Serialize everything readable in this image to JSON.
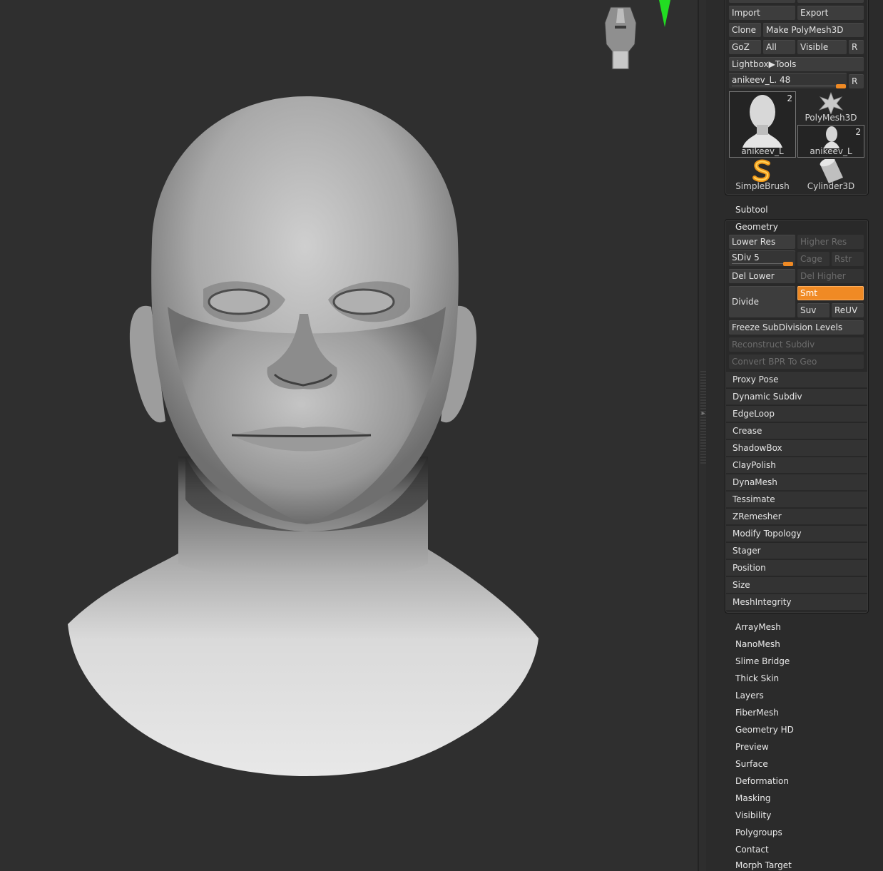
{
  "tool_top": {
    "import_label": "Import",
    "export_label": "Export",
    "clone_label": "Clone",
    "make_polymesh_label": "Make PolyMesh3D",
    "goz_label": "GoZ",
    "all_label": "All",
    "visible_label": "Visible",
    "r_label": "R",
    "lightbox_label": "Lightbox▶Tools",
    "current_tool_label": "anikeev_L. 48",
    "current_tool_value": 48,
    "r2_label": "R"
  },
  "tool_thumbs": [
    {
      "label": "anikeev_L",
      "count": "2",
      "icon": "head-bust-icon"
    },
    {
      "label": "PolyMesh3D",
      "count": "",
      "icon": "polymesh-star-icon"
    },
    {
      "label": "anikeev_L",
      "count": "2",
      "icon": "head-bust-small-icon"
    },
    {
      "label": "SimpleBrush",
      "count": "",
      "icon": "simplebrush-icon"
    },
    {
      "label": "Cylinder3D",
      "count": "",
      "icon": "cylinder-icon"
    }
  ],
  "subtool_label": "Subtool",
  "geometry": {
    "title": "Geometry",
    "lower_res": "Lower Res",
    "higher_res": "Higher Res",
    "sdiv_label": "SDiv 5",
    "sdiv_value": 5,
    "cage": "Cage",
    "rstr": "Rstr",
    "del_lower": "Del Lower",
    "del_higher": "Del Higher",
    "divide": "Divide",
    "smt": "Smt",
    "suv": "Suv",
    "reuv": "ReUV",
    "freeze": "Freeze SubDivision Levels",
    "reconstruct": "Reconstruct Subdiv",
    "convert_bpr": "Convert BPR To Geo",
    "sections": [
      "Proxy Pose",
      "Dynamic Subdiv",
      "EdgeLoop",
      "Crease",
      "ShadowBox",
      "ClayPolish",
      "DynaMesh",
      "Tessimate",
      "ZRemesher",
      "Modify Topology",
      "Stager",
      "Position",
      "Size",
      "MeshIntegrity"
    ]
  },
  "more_menus": [
    "ArrayMesh",
    "NanoMesh",
    "Slime Bridge",
    "Thick Skin",
    "Layers",
    "FiberMesh",
    "Geometry HD",
    "Preview",
    "Surface",
    "Deformation",
    "Masking",
    "Visibility",
    "Polygroups",
    "Contact",
    "Morph Target"
  ],
  "colors": {
    "accent": "#f08a24",
    "axis_y": "#22dd22",
    "viewport": "#2f2f2f"
  }
}
